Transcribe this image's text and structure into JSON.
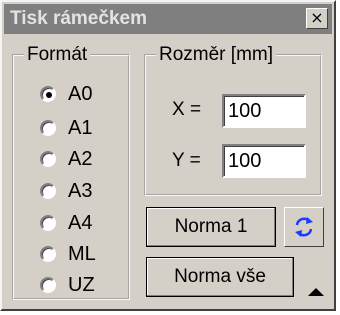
{
  "window": {
    "title": "Tisk rámečkem",
    "close_glyph": "×"
  },
  "format_group": {
    "legend": "Formát",
    "selected": "A0",
    "options": [
      "A0",
      "A1",
      "A2",
      "A3",
      "A4",
      "ML",
      "UZ"
    ]
  },
  "size_group": {
    "legend": "Rozměr [mm]",
    "x_label": "X =",
    "x_value": "100",
    "y_label": "Y =",
    "y_value": "100"
  },
  "buttons": {
    "norma1": "Norma 1",
    "norma_vse": "Norma vše",
    "swap_icon": "swap-arrows-icon",
    "expand_icon": "triangle-up-icon"
  },
  "colors": {
    "window_bg": "#d4d0c8",
    "titlebar_bg": "#7f7f7f",
    "title_text": "#e3e3e3",
    "swap_icon": "#1a3cff"
  }
}
